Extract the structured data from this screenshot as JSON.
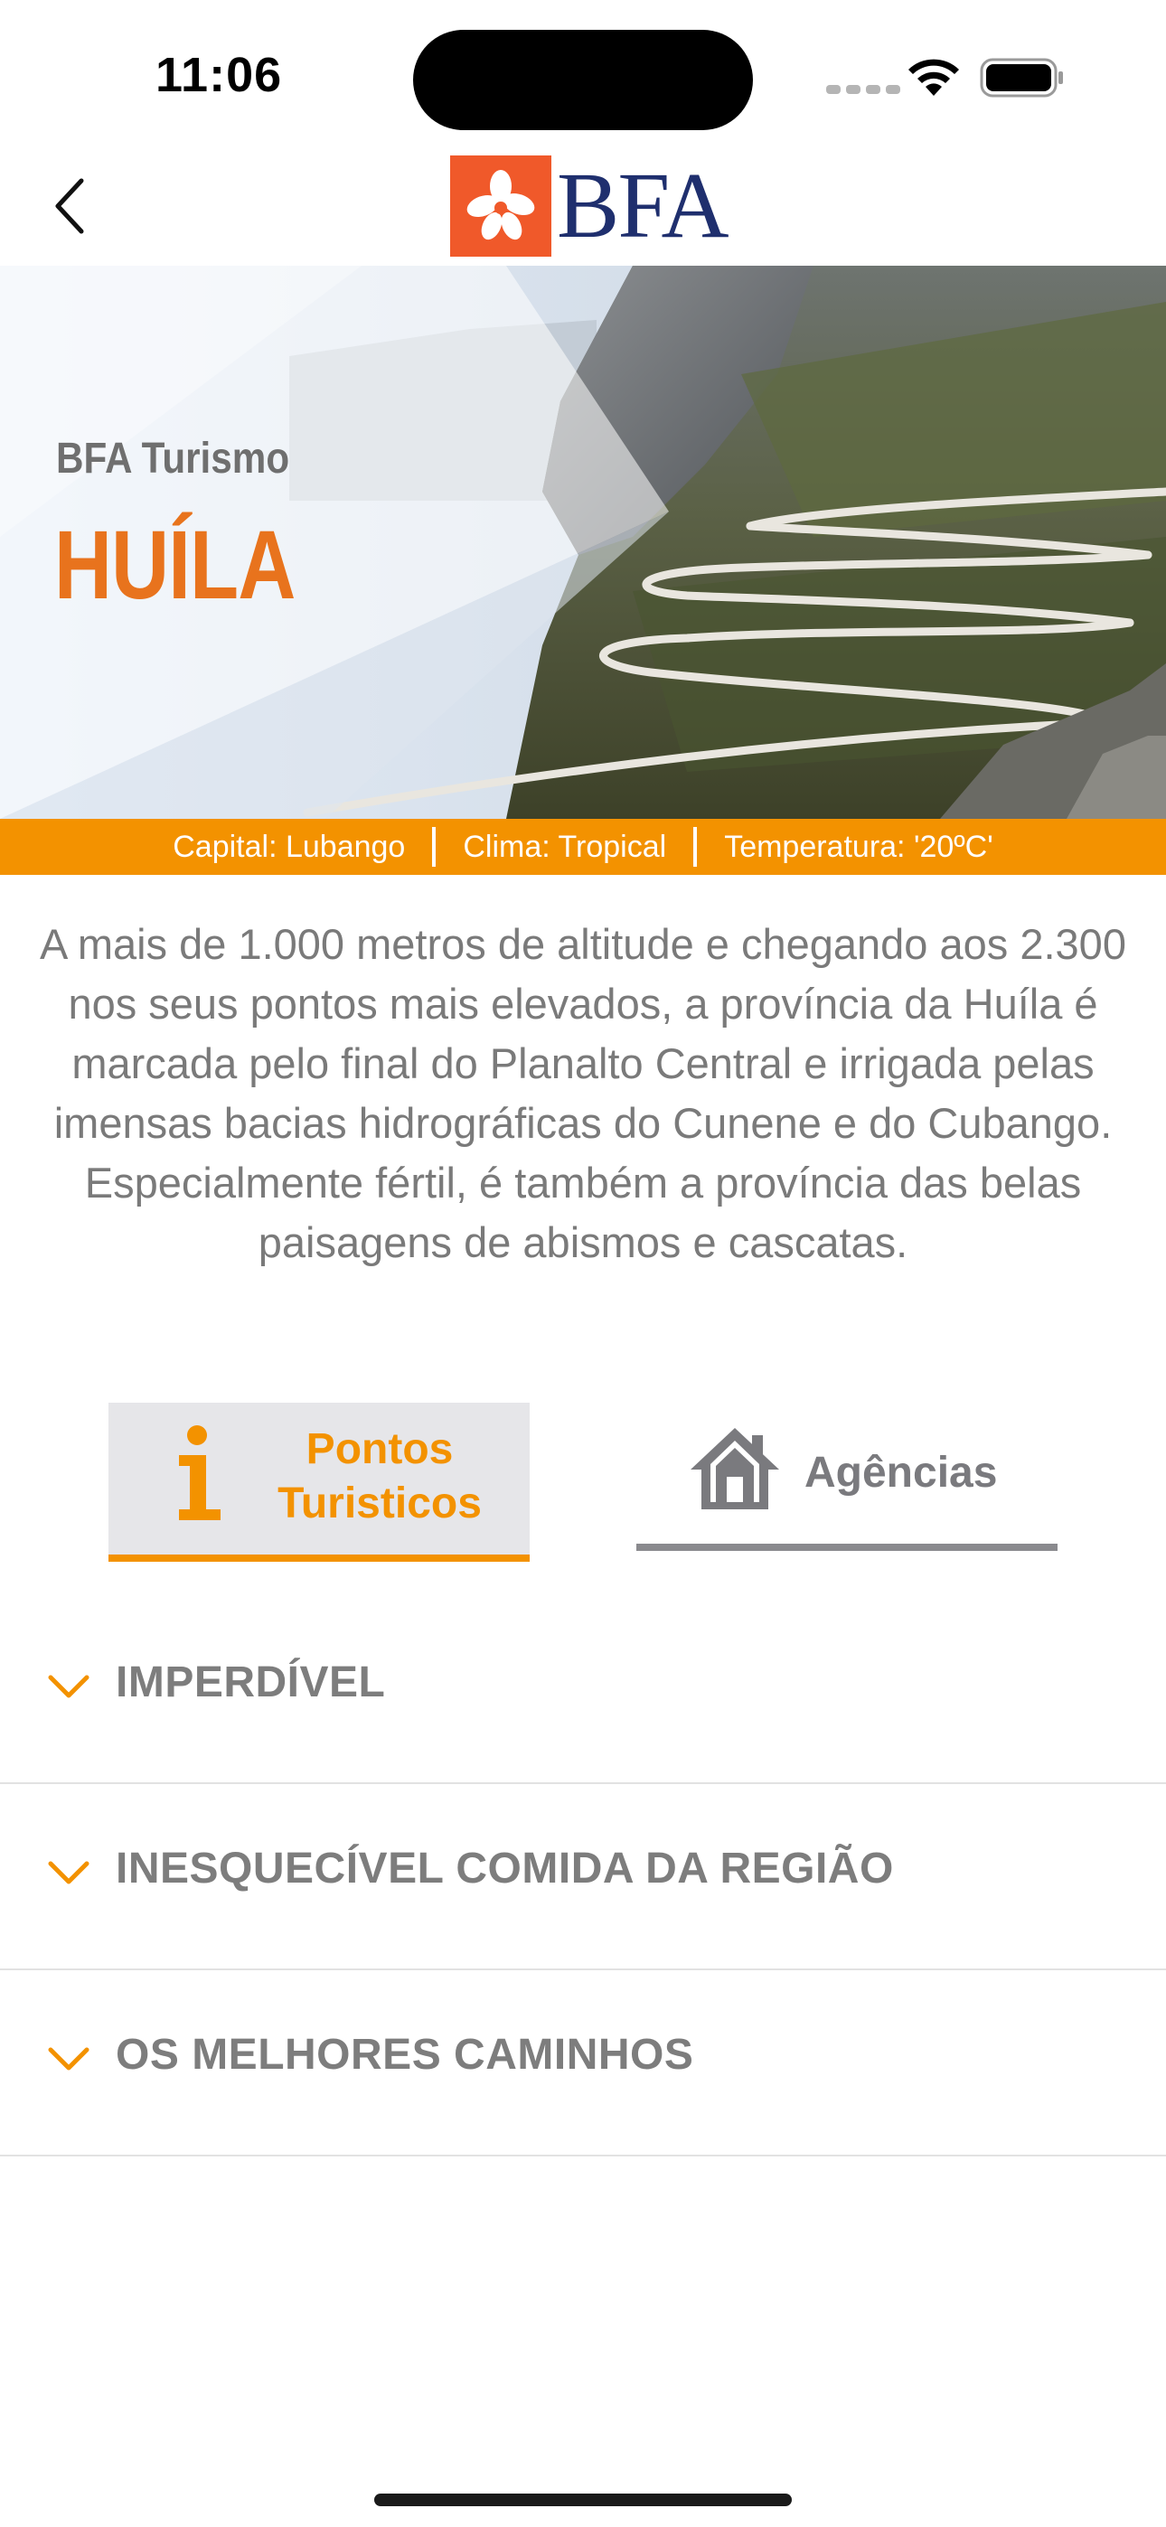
{
  "status_bar": {
    "time": "11:06"
  },
  "header": {
    "logo_text": "BFA"
  },
  "hero": {
    "kicker": "BFA Turismo",
    "title": "HUÍLA"
  },
  "info_strip": {
    "capital": "Capital: Lubango",
    "clima": "Clima: Tropical",
    "temperatura": "Temperatura: '20ºC'"
  },
  "description": "A mais de 1.000 metros de altitude e chegando aos 2.300 nos seus pontos mais elevados, a província da Huíla é marcada pelo final do Planalto Central e irrigada pelas imensas bacias hidrográficas do Cunene e do Cubango. Especialmente fértil, é também a província das belas paisagens de abismos e cascatas.",
  "tabs": [
    {
      "label_line1": "Pontos",
      "label_line2": "Turisticos",
      "icon": "info-icon",
      "selected": true
    },
    {
      "label": "Agências",
      "icon": "house-icon",
      "selected": false
    }
  ],
  "sections": [
    {
      "label": "IMPERDÍVEL"
    },
    {
      "label": "INESQUECÍVEL COMIDA DA REGIÃO"
    },
    {
      "label": "OS MELHORES CAMINHOS"
    }
  ],
  "colors": {
    "accent": "#f39200",
    "hero_title": "#e8731d",
    "logo_red": "#f0592a",
    "logo_navy": "#1f2f6e",
    "text_gray": "#7a7a7a"
  }
}
